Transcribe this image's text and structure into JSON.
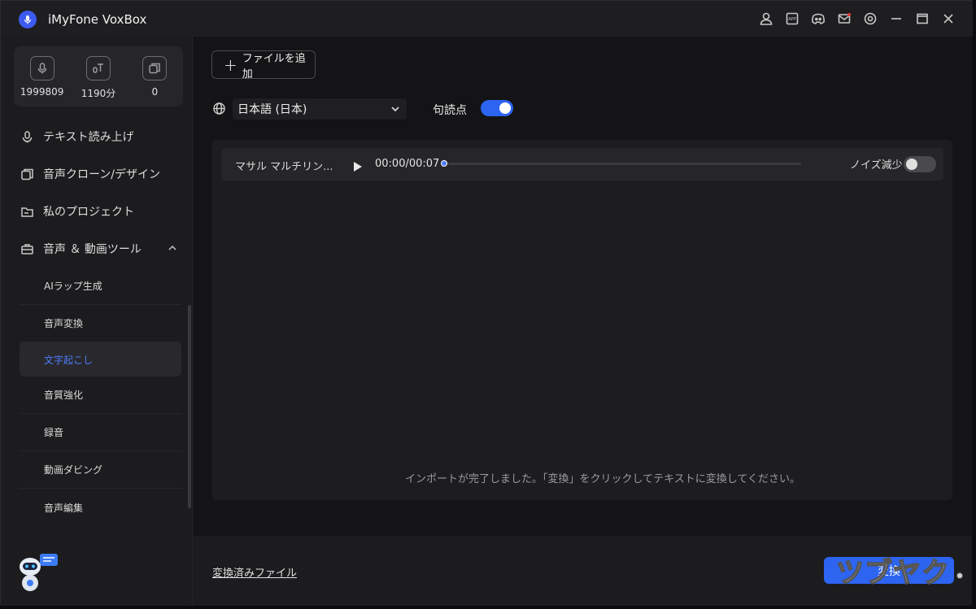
{
  "app": {
    "title": "iMyFone VoxBox"
  },
  "titlebar_icons": [
    "user-icon",
    "app-icon",
    "discord-icon",
    "mail-icon",
    "settings-icon",
    "minimize-icon",
    "maximize-icon",
    "close-icon"
  ],
  "stats": [
    {
      "icon": "mic-icon",
      "value": "1999809"
    },
    {
      "icon": "text-voice-icon",
      "value": "1190分"
    },
    {
      "icon": "clone-icon",
      "value": "0"
    }
  ],
  "nav": {
    "items": [
      {
        "label": "テキスト読み上げ",
        "icon": "tts-icon"
      },
      {
        "label": "音声クローン/デザイン",
        "icon": "voice-clone-icon"
      },
      {
        "label": "私のプロジェクト",
        "icon": "folder-icon"
      },
      {
        "label": "音声 ＆ 動画ツール",
        "icon": "toolbox-icon"
      }
    ],
    "sub_items": [
      {
        "label": "AIラップ生成"
      },
      {
        "label": "音声変換"
      },
      {
        "label": "文字起こし"
      },
      {
        "label": "音質強化"
      },
      {
        "label": "録音"
      },
      {
        "label": "動画ダビング"
      },
      {
        "label": "音声編集"
      }
    ],
    "active_sub": "文字起こし"
  },
  "main": {
    "add_file_label": "ファイルを追加",
    "language": "日本語 (日本)",
    "punctuation_label": "句読点",
    "punctuation_enabled": true,
    "file": {
      "name": "マサル マルチリン...",
      "time": "00:00/00:07",
      "progress": 0.0,
      "noise_label": "ノイズ減少",
      "noise_enabled": false
    },
    "hint": "インポートが完了しました。「変換」をクリックしてテキストに変換してください。"
  },
  "footer": {
    "converted_files_label": "変換済みファイル",
    "convert_label": "変換"
  },
  "watermark": "ツブヤク",
  "colors": {
    "accent": "#2d64f0",
    "link_active": "#4f7bff",
    "background": "#1c1c1e"
  }
}
